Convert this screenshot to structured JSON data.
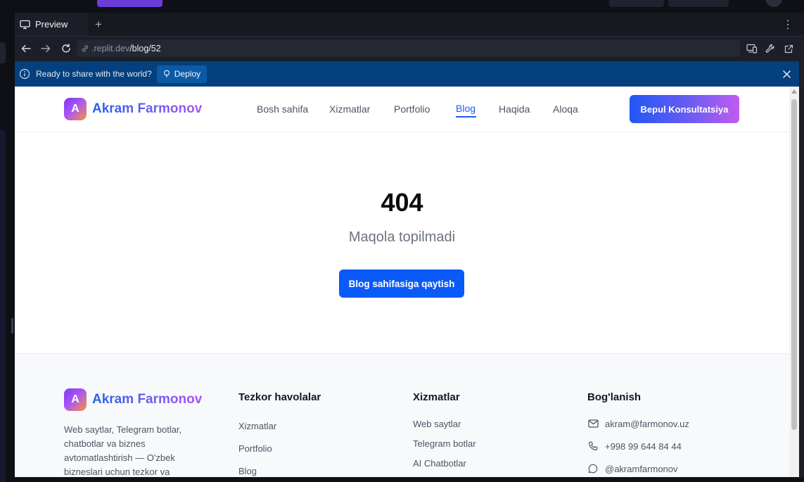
{
  "preview_tab": {
    "label": "Preview"
  },
  "url": {
    "host": ".replit.dev",
    "path": "/blog/52"
  },
  "banner": {
    "text": "Ready to share with the world?",
    "deploy_label": "Deploy"
  },
  "site": {
    "logo": {
      "badge": "A",
      "first": "Akram",
      "last": "Farmonov"
    },
    "nav": [
      {
        "label": "Bosh sahifa"
      },
      {
        "label": "Xizmatlar"
      },
      {
        "label": "Portfolio"
      },
      {
        "label": "Blog"
      },
      {
        "label": "Haqida"
      },
      {
        "label": "Aloqa"
      }
    ],
    "active_nav": "Blog",
    "cta_label": "Bepul Konsultatsiya",
    "error": {
      "code": "404",
      "message": "Maqola topilmadi",
      "button": "Blog sahifasiga qaytish"
    },
    "footer": {
      "description": "Web saytlar, Telegram botlar, chatbotlar va biznes avtomatlashtirish — O'zbek bizneslari uchun tezkor va",
      "quick_links": {
        "title": "Tezkor havolalar",
        "items": [
          "Xizmatlar",
          "Portfolio",
          "Blog"
        ]
      },
      "services": {
        "title": "Xizmatlar",
        "items": [
          "Web saytlar",
          "Telegram botlar",
          "AI Chatbotlar"
        ]
      },
      "contact": {
        "title": "Bog'lanish",
        "email": "akram@farmonov.uz",
        "phone": "+998 99 644 84 44",
        "telegram": "@akramfarmonov"
      }
    }
  },
  "colors": {
    "primary_blue": "#0a5af7",
    "banner_bg": "#03407d",
    "gradient_start": "#2563eb",
    "gradient_end": "#a855f7"
  }
}
